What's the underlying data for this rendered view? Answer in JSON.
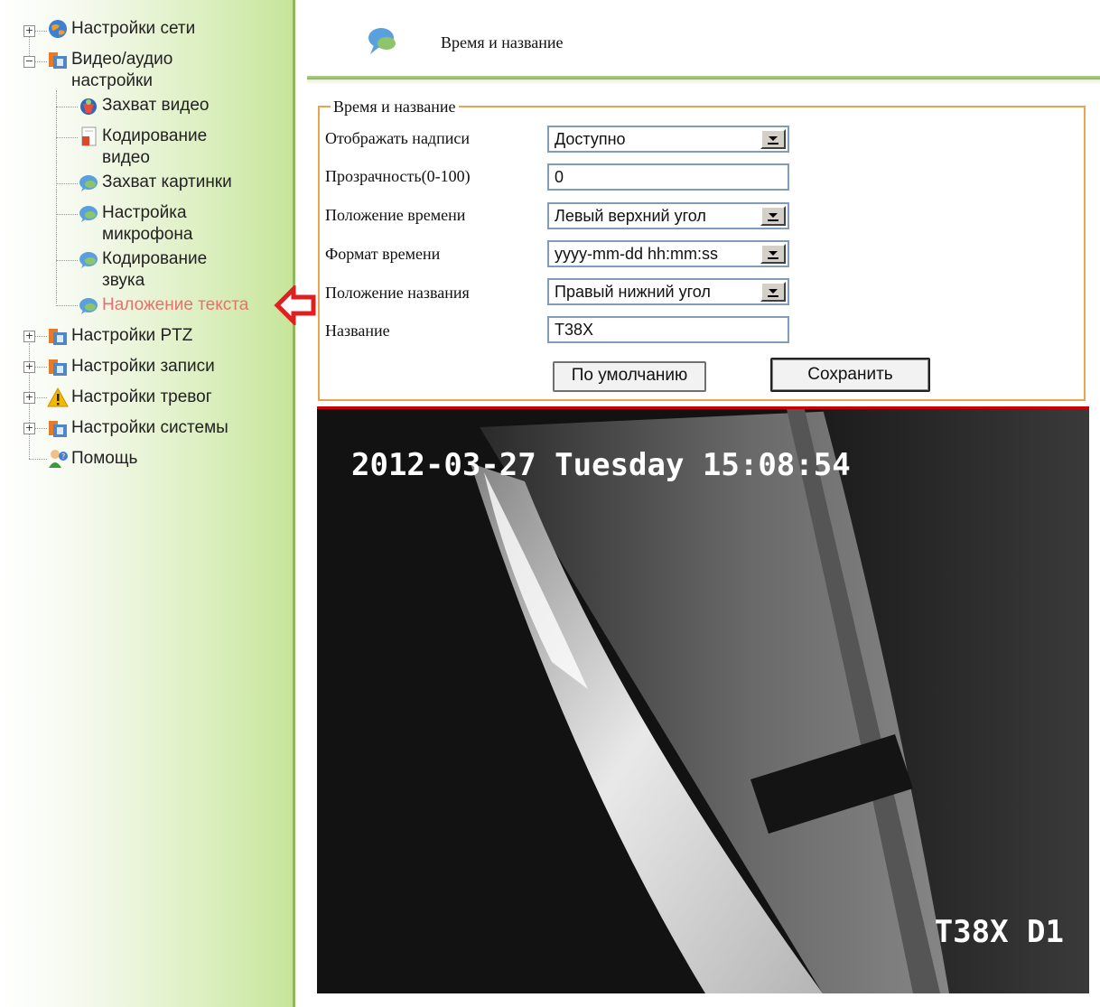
{
  "sidebar": {
    "items": [
      {
        "label": "Настройки сети",
        "icon": "globe-icon"
      },
      {
        "label": "Видео/аудио\nнастройки",
        "icon": "camera-folder-icon"
      },
      {
        "label": "Захват видео",
        "icon": "capture-icon"
      },
      {
        "label": "Кодирование\nвидео",
        "icon": "encoding-icon"
      },
      {
        "label": "Захват картинки",
        "icon": "bubble-icon"
      },
      {
        "label": "Настройка\nмикрофона",
        "icon": "bubble-icon"
      },
      {
        "label": "Кодирование\nзвука",
        "icon": "bubble-icon"
      },
      {
        "label": "Наложение текста",
        "icon": "bubble-icon",
        "active": true,
        "active_color": "#e9706b"
      },
      {
        "label": "Настройки PTZ",
        "icon": "camera-folder-icon"
      },
      {
        "label": "Настройки записи",
        "icon": "camera-folder-icon"
      },
      {
        "label": "Настройки тревог",
        "icon": "warning-icon"
      },
      {
        "label": "Настройки системы",
        "icon": "camera-folder-icon"
      },
      {
        "label": "Помощь",
        "icon": "help-person-icon"
      }
    ]
  },
  "header": {
    "title": "Время и название"
  },
  "form": {
    "legend": "Время и название",
    "rows": [
      {
        "label": "Отображать надписи",
        "value": "Доступно",
        "type": "select"
      },
      {
        "label": "Прозрачность(0-100)",
        "value": "0",
        "type": "input"
      },
      {
        "label": "Положение времени",
        "value": "Левый верхний угол",
        "type": "select"
      },
      {
        "label": "Формат времени",
        "value": "yyyy-mm-dd hh:mm:ss",
        "type": "select"
      },
      {
        "label": "Положение названия",
        "value": "Правый нижний угол",
        "type": "select"
      },
      {
        "label": "Название",
        "value": "T38X",
        "type": "input"
      }
    ],
    "default_button": "По умолчанию",
    "save_button": "Сохранить"
  },
  "video": {
    "osd_time": "2012-03-27 Tuesday 15:08:54",
    "osd_name": "T38X D1"
  },
  "colors": {
    "accent_border": "#e7a350",
    "video_top": "#cc0000",
    "sidebar_green": "#c6e59a"
  }
}
